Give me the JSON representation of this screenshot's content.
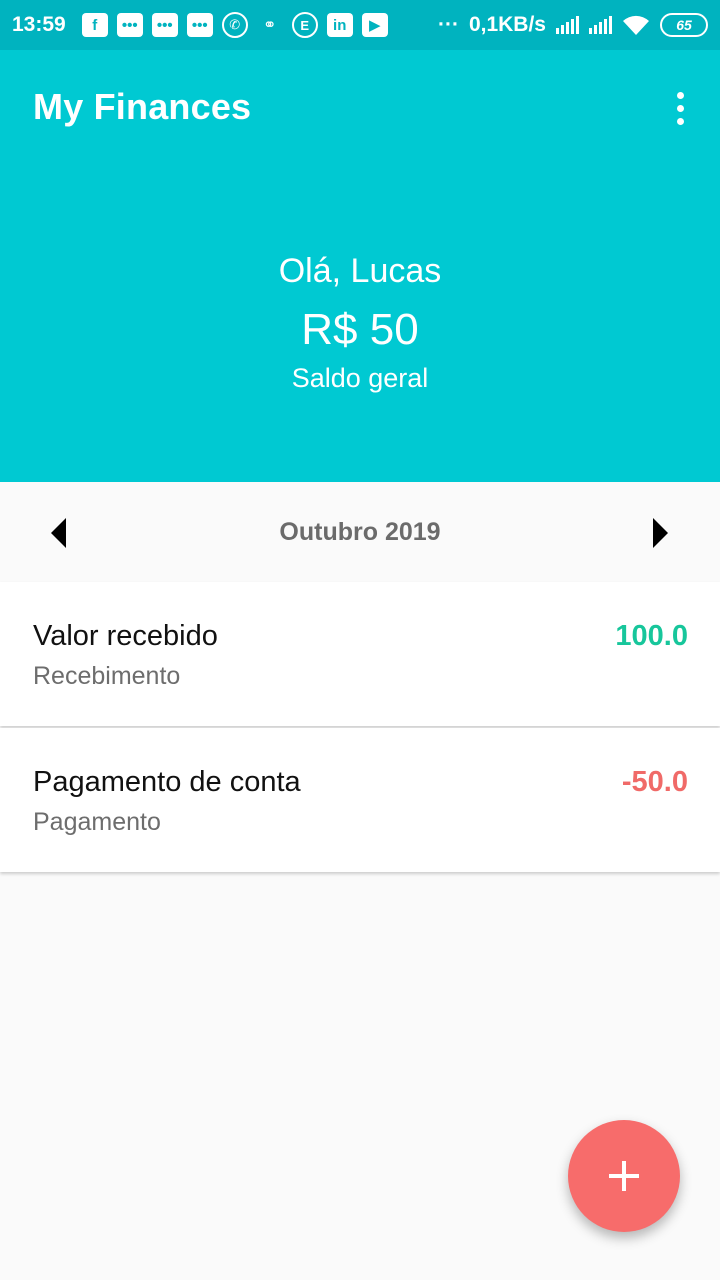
{
  "status_bar": {
    "time": "13:59",
    "network_speed": "0,1KB/s",
    "battery": "65",
    "overflow": "···",
    "icons": [
      "facebook-icon",
      "message-icon",
      "message-icon",
      "message-icon",
      "whatsapp-icon",
      "ring-icon",
      "e-icon",
      "linkedin-icon",
      "youtube-icon"
    ]
  },
  "app_bar": {
    "title": "My Finances",
    "menu_icon": "more-vert-icon"
  },
  "summary": {
    "greeting": "Olá, Lucas",
    "balance": "R$ 50",
    "balance_label": "Saldo geral"
  },
  "month_selector": {
    "label": "Outubro 2019",
    "prev_icon": "arrow-left-icon",
    "next_icon": "arrow-right-icon"
  },
  "transactions": [
    {
      "title": "Valor recebido",
      "category": "Recebimento",
      "amount": "100.0",
      "type": "income"
    },
    {
      "title": "Pagamento de conta",
      "category": "Pagamento",
      "amount": "-50.0",
      "type": "expense"
    }
  ],
  "fab": {
    "icon": "plus-icon"
  },
  "colors": {
    "status_bar": "#00b3bf",
    "primary": "#00c9d2",
    "income": "#17c69b",
    "expense": "#f06a68",
    "fab": "#f76c6b"
  }
}
